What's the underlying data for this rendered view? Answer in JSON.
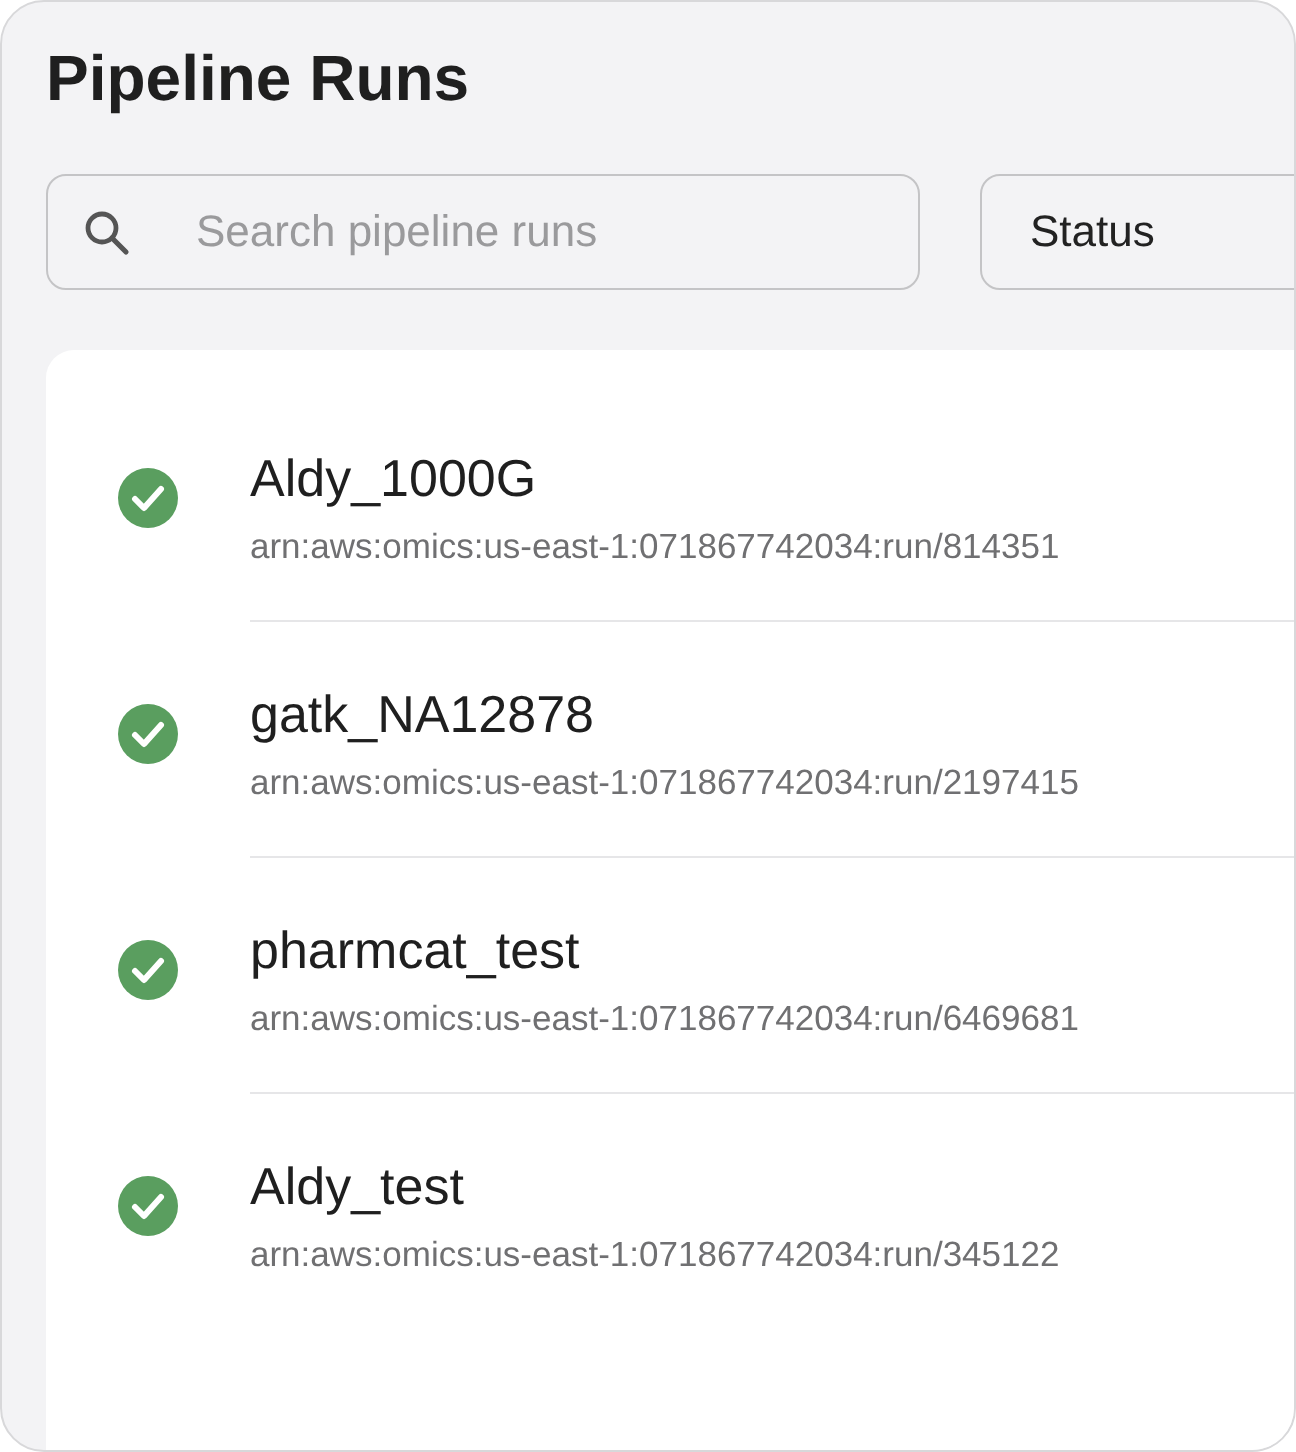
{
  "page": {
    "title": "Pipeline Runs"
  },
  "search": {
    "placeholder": "Search pipeline runs"
  },
  "status_filter": {
    "label": "Status"
  },
  "runs": [
    {
      "name": "Aldy_1000G",
      "arn": "arn:aws:omics:us-east-1:071867742034:run/814351",
      "succeeded": true
    },
    {
      "name": "gatk_NA12878",
      "arn": "arn:aws:omics:us-east-1:071867742034:run/2197415",
      "succeeded": true
    },
    {
      "name": "pharmcat_test",
      "arn": "arn:aws:omics:us-east-1:071867742034:run/6469681",
      "succeeded": true
    },
    {
      "name": "Aldy_test",
      "arn": "arn:aws:omics:us-east-1:071867742034:run/345122",
      "succeeded": true
    }
  ]
}
